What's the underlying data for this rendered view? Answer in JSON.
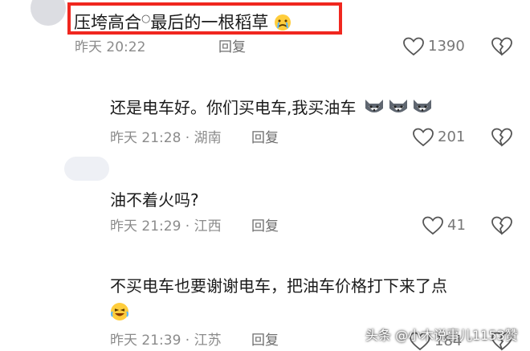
{
  "top_comment": {
    "username": "压垮高合",
    "text": "最后的一根稻草",
    "time": "昨天 20:22",
    "reply_label": "回复",
    "likes": "1390"
  },
  "replies": [
    {
      "text": "还是电车好。你们买电车,我买油车",
      "time": "昨天 21:28",
      "location": "湖南",
      "reply_label": "回复",
      "likes": "201"
    },
    {
      "text": "油不着火吗?",
      "time": "昨天 21:29",
      "location": "江西",
      "reply_label": "回复",
      "likes": "41"
    },
    {
      "text": "不买电车也要谢谢电车，把油车价格打下来了点",
      "time": "昨天 21:39",
      "location": "江苏",
      "reply_label": "回复",
      "likes": "184"
    }
  ],
  "watermark": "头条 @小木说事儿1153赞",
  "colors": {
    "highlight_border": "#f0271f",
    "meta_gray": "#8b8b8b"
  },
  "icons": [
    "heart-icon",
    "broken-heart-icon",
    "crying-emoji-icon",
    "husky-emoji-icon",
    "laughing-emoji-icon"
  ]
}
